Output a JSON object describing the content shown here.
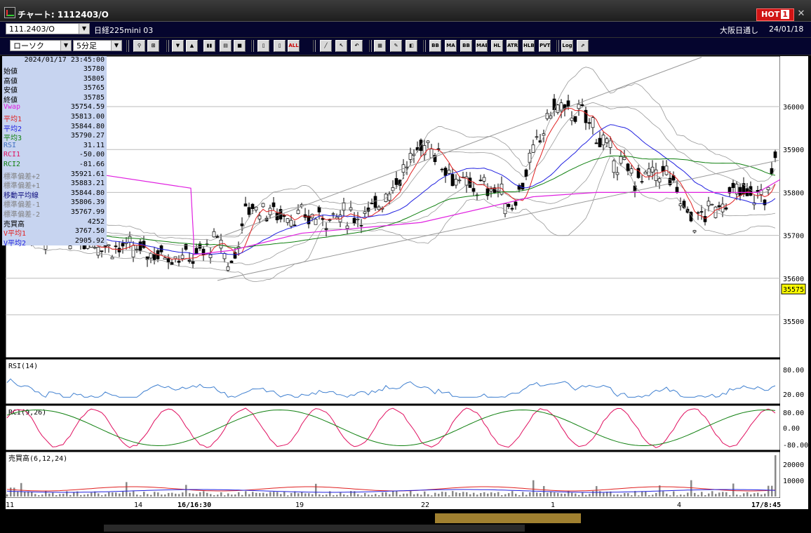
{
  "window": {
    "title": "チャート: 1112403/O",
    "hot_label": "HOT",
    "hot_badge": "1",
    "close_glyph": "✕"
  },
  "toolbar1": {
    "symbol": "111.2403/O",
    "name": "日経225mini 03",
    "session": "大阪日通し",
    "date": "24/01/18"
  },
  "toolbar2": {
    "chart_type": "ローソク",
    "interval": "5分足",
    "buttons": [
      "zoom",
      "crosshair",
      "arrow-down",
      "arrow-up",
      "candle-pair",
      "bar-mode",
      "lock",
      "candle-a",
      "candle-b",
      "ALL",
      "draw-line",
      "pointer",
      "undo",
      "grid",
      "brush",
      "palette",
      "BB",
      "MA",
      "BB",
      "MAE",
      "HL",
      "ATR",
      "HLB",
      "PVT",
      "Log",
      "export"
    ]
  },
  "info": {
    "datetime": "2024/01/17 23:45:00",
    "rows": [
      {
        "label": "始値",
        "value": "35780",
        "color": "#000000"
      },
      {
        "label": "高値",
        "value": "35805",
        "color": "#000000"
      },
      {
        "label": "安値",
        "value": "35765",
        "color": "#000000"
      },
      {
        "label": "終値",
        "value": "35785",
        "color": "#000000"
      },
      {
        "label": "Vwap",
        "value": "35754.59",
        "color": "#e020e0"
      },
      {
        "label": "平均1",
        "value": "35813.00",
        "color": "#e02020"
      },
      {
        "label": "平均2",
        "value": "35844.80",
        "color": "#2020e0"
      },
      {
        "label": "平均3",
        "value": "35790.27",
        "color": "#108010"
      },
      {
        "label": "RSI",
        "value": "31.11",
        "color": "#4070c0"
      },
      {
        "label": "RCI1",
        "value": "-50.00",
        "color": "#e01060"
      },
      {
        "label": "RCI2",
        "value": "-81.66",
        "color": "#108010"
      },
      {
        "label": "標準偏差+2",
        "value": "35921.61",
        "color": "#808080"
      },
      {
        "label": "標準偏差+1",
        "value": "35883.21",
        "color": "#808080"
      },
      {
        "label": "移動平均線",
        "value": "35844.80",
        "color": "#101080"
      },
      {
        "label": "標準偏差-1",
        "value": "35806.39",
        "color": "#808080"
      },
      {
        "label": "標準偏差-2",
        "value": "35767.99",
        "color": "#808080"
      },
      {
        "label": "売買高",
        "value": "4252",
        "color": "#000000"
      },
      {
        "label": "V平均1",
        "value": "3767.50",
        "color": "#e02020"
      },
      {
        "label": "V平均2",
        "value": "2905.92",
        "color": "#2020e0"
      }
    ]
  },
  "price_axis": {
    "ticks": [
      36000,
      35900,
      35800,
      35700,
      35600,
      35500
    ],
    "last_price": "35575"
  },
  "rsi_panel": {
    "title": "RSI(14)",
    "ticks": [
      "80.00",
      "20.00"
    ]
  },
  "rci_panel": {
    "title": "RCI(9,26)",
    "ticks": [
      "80.00",
      "0.00",
      "-80.00"
    ]
  },
  "vol_panel": {
    "title": "売買高(6,12,24)",
    "ticks": [
      "20000",
      "10000"
    ]
  },
  "x_axis": {
    "labels": [
      "11",
      "14",
      "16/16:30",
      "19",
      "22",
      "1",
      "4",
      "17/8:45"
    ]
  },
  "colors": {
    "bg": "#ffffff",
    "ma1": "#e02020",
    "ma2": "#2020e0",
    "ma3": "#108010",
    "vwap": "#e020e0",
    "bb": "#999999",
    "rsi": "#4080d0",
    "rci1": "#e01060",
    "rci2": "#108010"
  }
}
